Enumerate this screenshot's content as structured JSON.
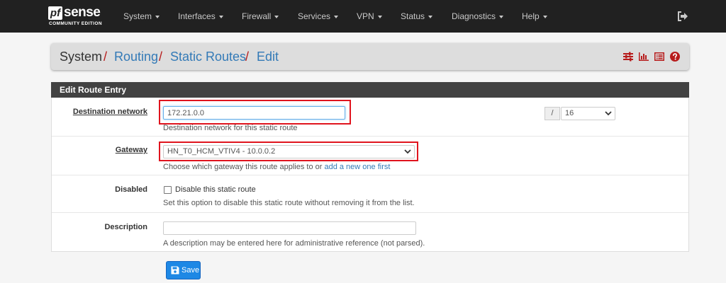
{
  "brand": {
    "logo_mark": "pf",
    "logo_word": "sense",
    "edition": "COMMUNITY EDITION"
  },
  "nav": {
    "items": [
      "System",
      "Interfaces",
      "Firewall",
      "Services",
      "VPN",
      "Status",
      "Diagnostics",
      "Help"
    ],
    "logout_icon": "sign-out-icon"
  },
  "breadcrumb": {
    "items": [
      "System",
      "Routing",
      "Static Routes",
      "Edit"
    ],
    "separator": "/"
  },
  "toolbar_icons": [
    "sliders-icon",
    "bar-chart-icon",
    "list-icon",
    "help-icon"
  ],
  "panel": {
    "title": "Edit Route Entry"
  },
  "form": {
    "destination": {
      "label": "Destination network",
      "value": "172.21.0.0",
      "help": "Destination network for this static route",
      "cidr_prefix": "/",
      "cidr_value": "16"
    },
    "gateway": {
      "label": "Gateway",
      "value": "HN_T0_HCM_VTIV4 - 10.0.0.2",
      "help_text": "Choose which gateway this route applies to or",
      "help_link": "add a new one first"
    },
    "disabled": {
      "label": "Disabled",
      "checkbox_label": "Disable this static route",
      "checked": false,
      "help": "Set this option to disable this static route without removing it from the list."
    },
    "description": {
      "label": "Description",
      "value": "",
      "help": "A description may be entered here for administrative reference (not parsed)."
    }
  },
  "actions": {
    "save_label": "Save"
  },
  "colors": {
    "navbar": "#212121",
    "accent_red": "#b71c1c",
    "link_blue": "#337ab7",
    "save_blue": "#1e88e5",
    "highlight_red": "#e0141e"
  }
}
